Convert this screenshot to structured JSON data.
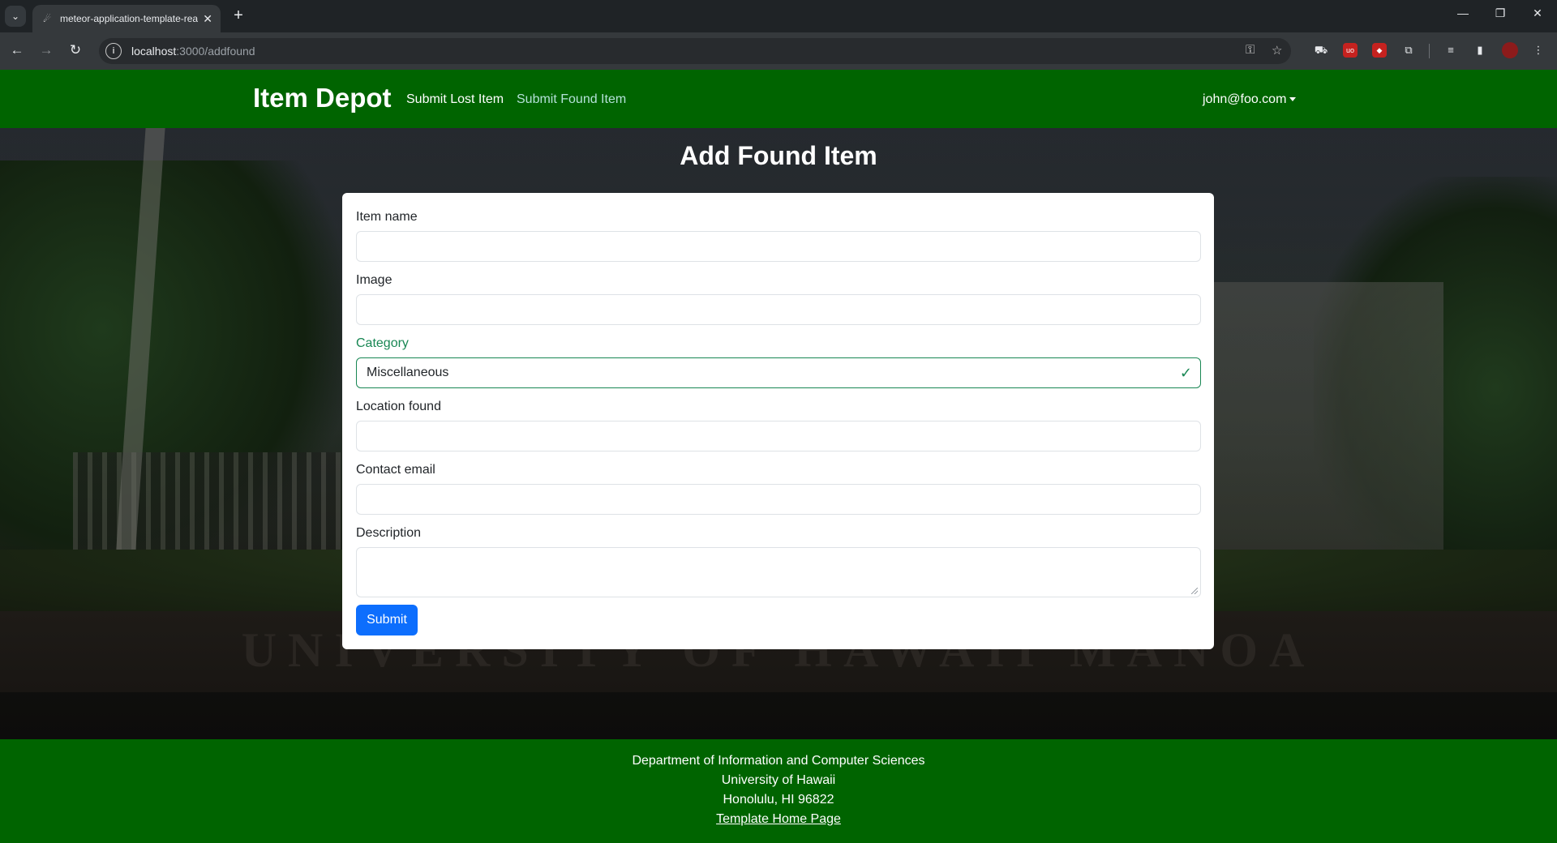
{
  "browser": {
    "tab_title": "meteor-application-template-react",
    "url_host": "localhost",
    "url_path": ":3000/addfound",
    "extension_badge": "0"
  },
  "navbar": {
    "brand": "Item Depot",
    "links": [
      "Submit Lost Item",
      "Submit Found Item"
    ],
    "user": "john@foo.com"
  },
  "form": {
    "title": "Add Found Item",
    "fields": {
      "item_name": {
        "label": "Item name",
        "value": ""
      },
      "image": {
        "label": "Image",
        "value": ""
      },
      "category": {
        "label": "Category",
        "value": "Miscellaneous"
      },
      "location": {
        "label": "Location found",
        "value": ""
      },
      "contact_email": {
        "label": "Contact email",
        "value": ""
      },
      "description": {
        "label": "Description",
        "value": ""
      }
    },
    "submit_label": "Submit"
  },
  "hero": {
    "sign_text": "UNIVERSITY OF HAWAII MĀNOA"
  },
  "footer": {
    "lines": [
      "Department of Information and Computer Sciences",
      "University of Hawaii",
      "Honolulu, HI 96822"
    ],
    "link": "Template Home Page"
  },
  "colors": {
    "navbar_green": "#006400",
    "active_link": "#b4e1d8",
    "valid_green": "#198754",
    "primary_blue": "#0d6efd"
  }
}
